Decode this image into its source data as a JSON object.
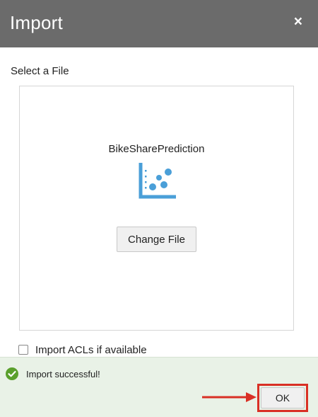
{
  "dialog": {
    "title": "Import",
    "close_symbol": "×",
    "close_icon": "close-icon"
  },
  "file_select": {
    "label": "Select a File",
    "file_name": "BikeSharePrediction",
    "file_icon": "scatter-plot-icon",
    "change_button_label": "Change File"
  },
  "options": {
    "import_acls_label": "Import ACLs if available",
    "import_acls_checked": false
  },
  "footer": {
    "status_icon": "check-circle-icon",
    "status_text": "Import successful!",
    "ok_label": "OK",
    "annotation_arrow": "arrow-right-icon"
  },
  "colors": {
    "header_bg": "#6b6b6b",
    "accent_blue": "#4a9fd8",
    "success_green": "#5aa02c",
    "footer_bg": "#e9f2e7",
    "annotation_red": "#d93025"
  }
}
